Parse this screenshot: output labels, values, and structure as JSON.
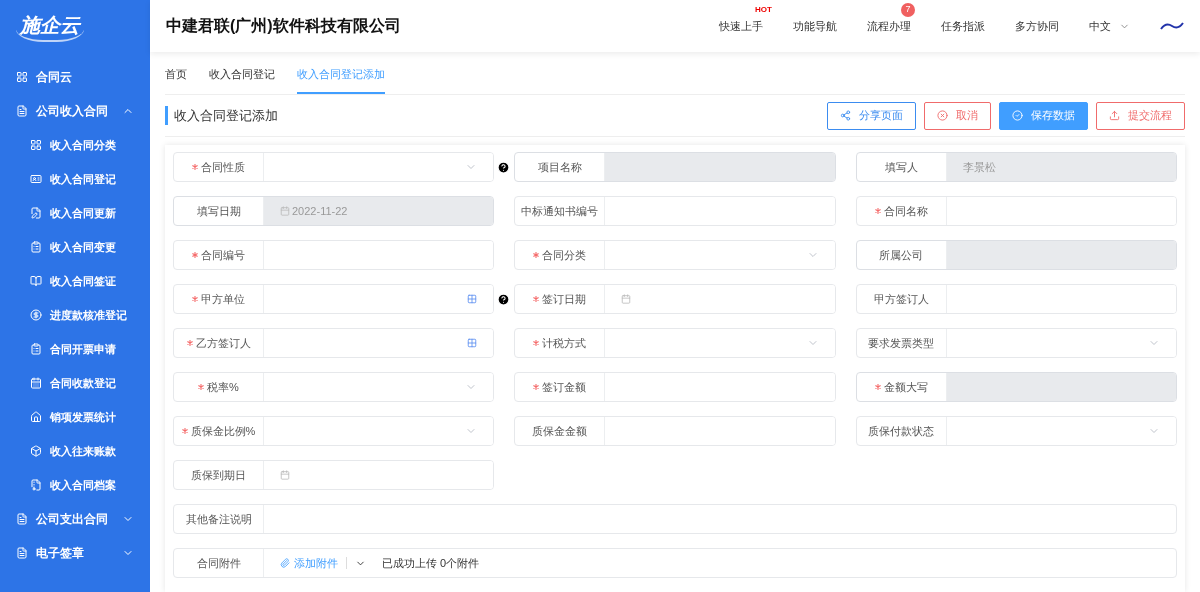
{
  "sidebar": {
    "logo": "施企云",
    "items": [
      {
        "label": "合同云",
        "kind": "link"
      },
      {
        "label": "公司收入合同",
        "kind": "group",
        "expanded": true,
        "children": [
          {
            "label": "收入合同分类"
          },
          {
            "label": "收入合同登记"
          },
          {
            "label": "收入合同更新"
          },
          {
            "label": "收入合同变更"
          },
          {
            "label": "收入合同签证"
          },
          {
            "label": "进度款核准登记"
          },
          {
            "label": "合同开票申请"
          },
          {
            "label": "合同收款登记"
          },
          {
            "label": "销项发票统计"
          },
          {
            "label": "收入往来账款"
          },
          {
            "label": "收入合同档案"
          }
        ]
      },
      {
        "label": "公司支出合同",
        "kind": "group",
        "expanded": false
      },
      {
        "label": "电子签章",
        "kind": "group",
        "expanded": false
      }
    ]
  },
  "header": {
    "company": "中建君联(广州)软件科技有限公司",
    "nav": [
      {
        "label": "快速上手",
        "hot_badge": "HOT"
      },
      {
        "label": "功能导航"
      },
      {
        "label": "流程办理",
        "count_badge": "7"
      },
      {
        "label": "任务指派"
      },
      {
        "label": "多方协同"
      }
    ],
    "language": "中文"
  },
  "tabs": [
    {
      "label": "首页",
      "selected": false
    },
    {
      "label": "收入合同登记",
      "selected": false
    },
    {
      "label": "收入合同登记添加",
      "selected": true
    }
  ],
  "page_title": "收入合同登记添加",
  "buttons": [
    {
      "label": "分享页面",
      "kind": "share"
    },
    {
      "label": "取消",
      "kind": "cancel"
    },
    {
      "label": "保存数据",
      "kind": "save"
    },
    {
      "label": "提交流程",
      "kind": "submit"
    }
  ],
  "form": {
    "fields": [
      {
        "label": "合同性质",
        "required": true,
        "kind": "select",
        "disabled": false
      },
      {
        "label": "项目名称",
        "required": false,
        "kind": "input",
        "disabled": true,
        "help": true
      },
      {
        "label": "填写人",
        "required": false,
        "kind": "input",
        "disabled": true,
        "value": "李景松"
      },
      {
        "label": "填写日期",
        "required": false,
        "kind": "date",
        "disabled": true,
        "value": "2022-11-22"
      },
      {
        "label": "中标通知书编号",
        "required": false,
        "kind": "input",
        "disabled": false
      },
      {
        "label": "合同名称",
        "required": true,
        "kind": "input",
        "disabled": false
      },
      {
        "label": "合同编号",
        "required": true,
        "kind": "input",
        "disabled": false
      },
      {
        "label": "合同分类",
        "required": true,
        "kind": "select",
        "disabled": false
      },
      {
        "label": "所属公司",
        "required": false,
        "kind": "input",
        "disabled": true
      },
      {
        "label": "甲方单位",
        "required": true,
        "kind": "picker",
        "disabled": false
      },
      {
        "label": "签订日期",
        "required": true,
        "kind": "date",
        "disabled": false,
        "help": true
      },
      {
        "label": "甲方签订人",
        "required": false,
        "kind": "input",
        "disabled": false
      },
      {
        "label": "乙方签订人",
        "required": true,
        "kind": "picker",
        "disabled": false
      },
      {
        "label": "计税方式",
        "required": true,
        "kind": "select",
        "disabled": false
      },
      {
        "label": "要求发票类型",
        "required": false,
        "kind": "select",
        "disabled": false
      },
      {
        "label": "税率%",
        "required": true,
        "kind": "select",
        "disabled": false
      },
      {
        "label": "签订金额",
        "required": true,
        "kind": "input",
        "disabled": false
      },
      {
        "label": "金额大写",
        "required": true,
        "kind": "input",
        "disabled": true
      },
      {
        "label": "质保金比例%",
        "required": true,
        "kind": "select",
        "disabled": false
      },
      {
        "label": "质保金金额",
        "required": false,
        "kind": "input",
        "disabled": false
      },
      {
        "label": "质保付款状态",
        "required": false,
        "kind": "select",
        "disabled": false
      },
      {
        "label": "质保到期日",
        "required": false,
        "kind": "date",
        "disabled": false
      }
    ],
    "remarks": {
      "label": "其他备注说明"
    },
    "attachments": {
      "label": "合同附件",
      "add": "添加附件",
      "status": "已成功上传 0个附件"
    }
  }
}
